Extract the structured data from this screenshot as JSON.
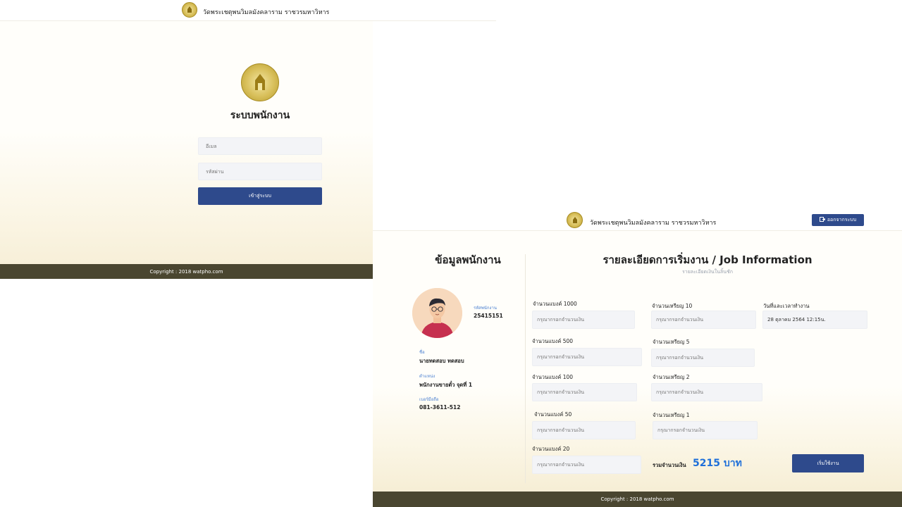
{
  "site": {
    "name": "วัดพระเชตุพนวิมลมังคลาราม ราชวรมหาวิหาร"
  },
  "login": {
    "title": "ระบบพนักงาน",
    "email_placeholder": "อีเมล",
    "password_placeholder": "รหัสผ่าน",
    "submit_label": "เข้าสู่ระบบ",
    "footer": "Copyright : 2018 watpho.com"
  },
  "dashboard": {
    "logout_label": "ออกจากระบบ",
    "employee": {
      "heading": "ข้อมูลพนักงาน",
      "id_label": "รหัสพนักงาน",
      "id_value": "25415151",
      "name_label": "ชื่อ",
      "name_value": "นายทดสอบ ทดสอบ",
      "position_label": "ตำแหน่ง",
      "position_value": "พนักงานขายตั๋ว จุดที่ 1",
      "phone_label": "เบอร์มือถือ",
      "phone_value": "081-3611-512"
    },
    "job": {
      "title": "รายละเอียดการเริ่มงาน / Job Information",
      "subtitle": "รายละเอียดเงินในลิ้นชัก",
      "placeholder": "กรุณากรอกจำนวนเงิน",
      "banknotes": [
        {
          "label": "จำนวนแบงค์ 1000"
        },
        {
          "label": "จำนวนแบงค์ 500"
        },
        {
          "label": "จำนวนแบงค์ 100"
        },
        {
          "label": "จำนวนแบงค์ 50"
        },
        {
          "label": "จำนวนแบงค์ 20"
        }
      ],
      "coins": [
        {
          "label": "จำนวนเหรียญ 10"
        },
        {
          "label": "จำนวนเหรียญ 5"
        },
        {
          "label": "จำนวนเหรียญ 2"
        },
        {
          "label": "จำนวนเหรียญ 1"
        }
      ],
      "datetime_label": "วันที่และเวลาทำงาน",
      "datetime_value": "28 ตุลาคม 2564 12:15น.",
      "total_label": "รวมจำนวนเงิน",
      "total_value": "5215 บาท",
      "start_label": "เริ่มใช้งาน"
    },
    "footer": "Copyright : 2018 watpho.com"
  },
  "colors": {
    "primary": "#2e4a8c",
    "footer": "#4a4630",
    "accent_blue": "#1e6fd9",
    "gold": "#c9ad3f"
  }
}
